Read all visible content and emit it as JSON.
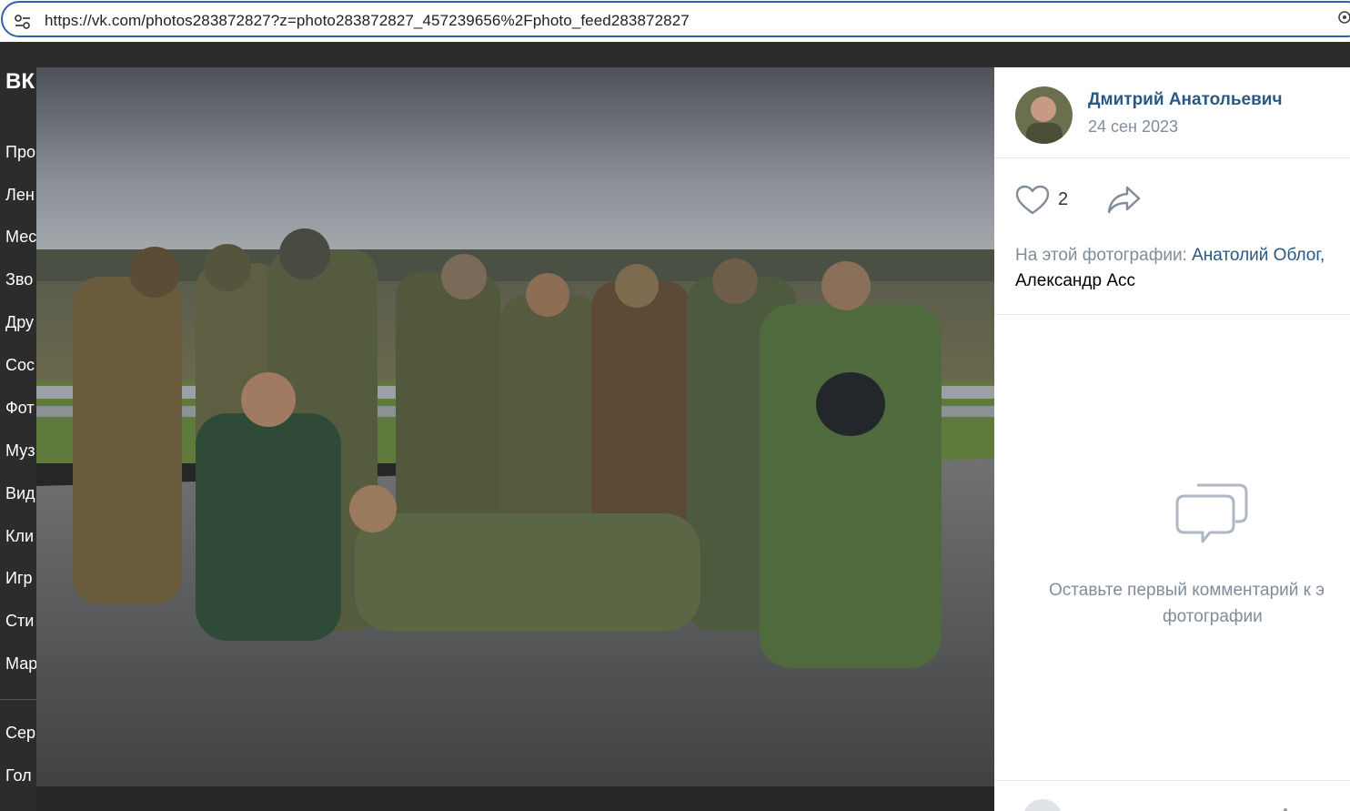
{
  "browser": {
    "url": "https://vk.com/photos283872827?z=photo283872827_457239656%2Fphoto_feed283872827"
  },
  "vk": {
    "logo": "ВК",
    "menu": [
      "Про",
      "Лен",
      "Мес",
      "Зво",
      "Дру",
      "Сос",
      "Фот",
      "Муз",
      "Вид",
      "Кли",
      "Игр",
      "Сти",
      "Мар",
      "Сер",
      "Гол"
    ]
  },
  "photo": {
    "alt": "Group of men in camouflage posing on a wet road"
  },
  "panel": {
    "author_name": "Дмитрий Анатольевич",
    "date": "24 сен 2023",
    "likes": "2",
    "tags_prefix": "На этой фотографии: ",
    "tag1": "Анатолий Облог",
    "tag_sep": ",",
    "tag2": "Александр Асс",
    "empty_line1": "Оставьте первый комментарий к э",
    "empty_line2": "фотографии"
  },
  "colors": {
    "link": "#2a5885",
    "muted": "#818c99",
    "address_border": "#2f5fb0"
  },
  "icons": [
    "tune-icon",
    "extension-icon",
    "heart-icon",
    "share-icon",
    "comment-bubbles-icon"
  ]
}
